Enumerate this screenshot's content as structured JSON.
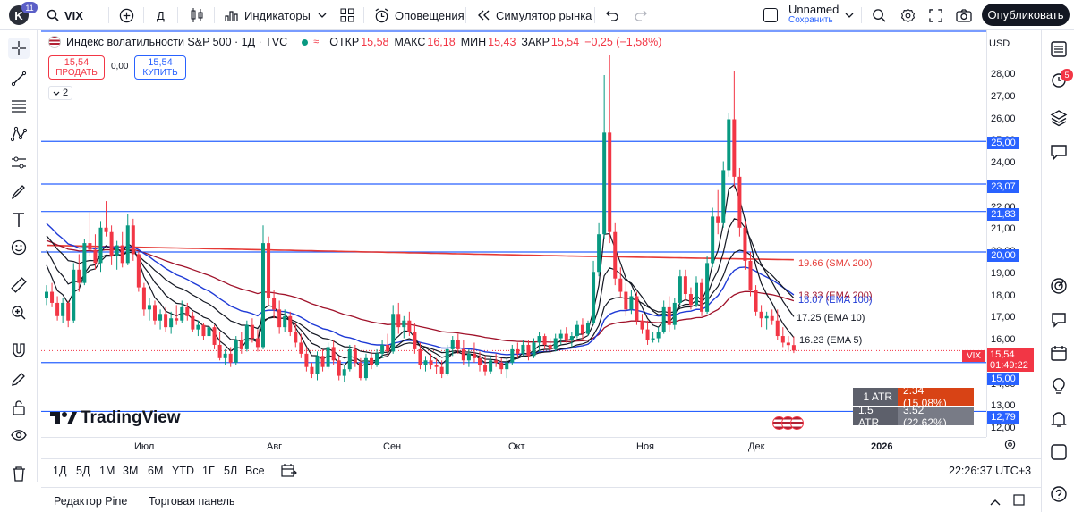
{
  "topbar": {
    "avatar_letter": "K",
    "avatar_badge": "11",
    "symbol": "VIX",
    "interval": "Д",
    "indicators_label": "Индикаторы",
    "alerts_label": "Оповещения",
    "replay_label": "Симулятор рынка",
    "layout_name": "Unnamed",
    "layout_status": "Сохранить",
    "publish_label": "Опубликовать"
  },
  "legend": {
    "title": "Индекс волатильности S&P 500 · 1Д · TVC",
    "open_label": "ОТКР",
    "open": "15,58",
    "high_label": "МАКС",
    "high": "16,18",
    "low_label": "МИН",
    "low": "15,43",
    "close_label": "ЗАКР",
    "close": "15,54",
    "change": "−0,25 (−1,58%)",
    "sell_price": "15,54",
    "sell_label": "ПРОДАТЬ",
    "spread": "0,00",
    "buy_price": "15,54",
    "buy_label": "КУПИТЬ",
    "collapse_count": "2"
  },
  "price_axis": {
    "currency": "USD",
    "labels": [
      "28,00",
      "27,00",
      "26,00",
      "25,00",
      "24,00",
      "23,00",
      "22,00",
      "21,00",
      "20,00",
      "19,00",
      "18,00",
      "17,00",
      "16,00",
      "15,00",
      "14,00",
      "13,00",
      "12,00"
    ]
  },
  "level_tags": [
    "25,00",
    "23,07",
    "21,83",
    "20,00",
    "15,00",
    "12,79"
  ],
  "price_tag": {
    "symbol": "VIX",
    "value": "15,54",
    "timer": "01:49:22"
  },
  "ma_labels": {
    "sma200": "19.66 (SMA 200)",
    "ema200": "18.33 (EMA 200)",
    "ema100": "18.07 (EMA 100)",
    "ema10": "17.25 (EMA 10)",
    "ema5": "16.23 (EMA 5)"
  },
  "atr": [
    {
      "label": "1 ATR",
      "value": "2.34 (15.08%)"
    },
    {
      "label": "1.5 ATR",
      "value": "3.52 (22.62%)"
    }
  ],
  "watermark": "TradingView",
  "time_axis": {
    "labels": [
      "Июл",
      "Авг",
      "Сен",
      "Окт",
      "Ноя",
      "Дек"
    ],
    "year": "2026"
  },
  "ranges": [
    "1Д",
    "5Д",
    "1М",
    "3М",
    "6М",
    "YTD",
    "1Г",
    "5Л",
    "Все"
  ],
  "clock": "22:26:37 UTC+3",
  "footer": {
    "pine": "Редактор Pine",
    "trading": "Торговая панель"
  },
  "alerts_badge": "5",
  "colors": {
    "up": "#089981",
    "down": "#f23645",
    "level": "#2962ff",
    "sma": "#e53935",
    "ema": "#1e3ad6"
  },
  "chart_data": {
    "type": "candlestick",
    "symbol": "VIX",
    "interval": "1D",
    "ylim": [
      12,
      28.8
    ],
    "horizontal_levels": [
      25.0,
      23.07,
      21.83,
      20.0,
      15.0,
      12.79
    ],
    "candles": [
      [
        17.9,
        18.5,
        17.6,
        18.2
      ],
      [
        18.2,
        18.6,
        17.5,
        17.7
      ],
      [
        17.7,
        18.0,
        16.9,
        17.1
      ],
      [
        17.1,
        17.9,
        16.8,
        17.7
      ],
      [
        17.7,
        17.8,
        16.6,
        16.9
      ],
      [
        16.9,
        19.5,
        16.8,
        19.2
      ],
      [
        19.2,
        19.9,
        18.2,
        18.6
      ],
      [
        18.6,
        20.6,
        18.5,
        20.4
      ],
      [
        20.4,
        21.8,
        19.8,
        20.1
      ],
      [
        20.1,
        20.8,
        19.2,
        19.5
      ],
      [
        19.5,
        21.4,
        19.1,
        21.1
      ],
      [
        21.1,
        22.3,
        20.7,
        20.9
      ],
      [
        20.9,
        21.2,
        19.4,
        19.8
      ],
      [
        19.8,
        20.5,
        19.2,
        20.3
      ],
      [
        20.3,
        20.9,
        19.3,
        19.5
      ],
      [
        19.5,
        21.7,
        19.4,
        21.2
      ],
      [
        21.2,
        21.5,
        19.6,
        19.9
      ],
      [
        19.9,
        20.0,
        18.2,
        18.4
      ],
      [
        18.4,
        18.6,
        17.1,
        17.4
      ],
      [
        17.4,
        17.9,
        16.9,
        17.6
      ],
      [
        17.6,
        17.8,
        16.7,
        16.9
      ],
      [
        16.9,
        17.4,
        16.5,
        17.2
      ],
      [
        17.2,
        17.5,
        16.4,
        16.6
      ],
      [
        16.6,
        17.3,
        16.3,
        17.0
      ],
      [
        17.0,
        17.6,
        16.7,
        16.9
      ],
      [
        16.9,
        17.8,
        16.8,
        17.5
      ],
      [
        17.5,
        17.7,
        16.9,
        17.1
      ],
      [
        17.1,
        17.3,
        16.4,
        16.5
      ],
      [
        16.5,
        16.9,
        16.2,
        16.7
      ],
      [
        16.7,
        16.8,
        16.0,
        16.2
      ],
      [
        16.2,
        16.9,
        15.9,
        16.6
      ],
      [
        16.6,
        16.7,
        15.6,
        15.8
      ],
      [
        15.8,
        16.4,
        15.1,
        15.2
      ],
      [
        15.2,
        15.6,
        14.9,
        15.4
      ],
      [
        15.4,
        15.7,
        14.8,
        15.0
      ],
      [
        15.0,
        16.2,
        14.9,
        16.0
      ],
      [
        16.0,
        16.4,
        15.4,
        15.6
      ],
      [
        15.6,
        16.9,
        15.5,
        16.7
      ],
      [
        16.7,
        17.0,
        15.9,
        16.1
      ],
      [
        16.1,
        16.5,
        15.5,
        15.7
      ],
      [
        15.7,
        21.2,
        15.6,
        20.4
      ],
      [
        20.4,
        20.7,
        17.6,
        17.9
      ],
      [
        17.9,
        18.3,
        17.0,
        17.4
      ],
      [
        17.4,
        17.8,
        16.3,
        16.6
      ],
      [
        16.6,
        17.4,
        16.4,
        17.1
      ],
      [
        17.1,
        17.3,
        16.2,
        16.4
      ],
      [
        16.4,
        16.8,
        15.7,
        15.9
      ],
      [
        15.9,
        16.3,
        15.2,
        15.4
      ],
      [
        15.4,
        15.7,
        14.6,
        14.8
      ],
      [
        14.8,
        15.0,
        14.3,
        14.5
      ],
      [
        14.5,
        15.5,
        14.2,
        15.3
      ],
      [
        15.3,
        15.6,
        14.6,
        14.8
      ],
      [
        14.8,
        15.9,
        14.7,
        15.7
      ],
      [
        15.7,
        16.0,
        14.9,
        15.1
      ],
      [
        15.1,
        15.3,
        14.2,
        14.4
      ],
      [
        14.4,
        14.9,
        14.1,
        14.7
      ],
      [
        14.7,
        15.8,
        14.6,
        15.6
      ],
      [
        15.6,
        15.8,
        14.8,
        15.0
      ],
      [
        15.0,
        15.2,
        14.2,
        14.3
      ],
      [
        14.3,
        15.4,
        14.2,
        15.2
      ],
      [
        15.2,
        15.5,
        14.7,
        14.9
      ],
      [
        14.9,
        15.6,
        14.8,
        15.4
      ],
      [
        15.4,
        16.0,
        15.2,
        15.8
      ],
      [
        15.8,
        16.3,
        15.3,
        15.5
      ],
      [
        15.5,
        17.6,
        15.4,
        17.2
      ],
      [
        17.2,
        17.7,
        16.3,
        16.6
      ],
      [
        16.6,
        17.1,
        16.1,
        16.9
      ],
      [
        16.9,
        17.3,
        16.2,
        16.4
      ],
      [
        16.4,
        16.8,
        15.4,
        15.6
      ],
      [
        15.6,
        15.9,
        14.7,
        14.9
      ],
      [
        14.9,
        15.3,
        14.6,
        15.1
      ],
      [
        15.1,
        15.4,
        14.7,
        14.9
      ],
      [
        14.9,
        15.2,
        14.5,
        14.8
      ],
      [
        14.8,
        15.1,
        14.3,
        14.5
      ],
      [
        14.5,
        15.8,
        14.4,
        15.6
      ],
      [
        15.6,
        16.2,
        15.3,
        16.0
      ],
      [
        16.0,
        16.3,
        15.4,
        15.6
      ],
      [
        15.6,
        16.0,
        14.9,
        15.1
      ],
      [
        15.1,
        15.6,
        14.8,
        15.4
      ],
      [
        15.4,
        15.9,
        15.0,
        15.2
      ],
      [
        15.2,
        15.5,
        14.6,
        14.9
      ],
      [
        14.9,
        15.3,
        14.4,
        14.6
      ],
      [
        14.6,
        15.3,
        14.5,
        15.1
      ],
      [
        15.1,
        15.4,
        14.8,
        15.0
      ],
      [
        15.0,
        15.2,
        14.5,
        14.7
      ],
      [
        14.7,
        15.2,
        14.3,
        15.0
      ],
      [
        15.0,
        15.8,
        14.9,
        15.6
      ],
      [
        15.6,
        15.9,
        15.2,
        15.4
      ],
      [
        15.4,
        16.0,
        15.3,
        15.8
      ],
      [
        15.8,
        16.0,
        15.1,
        15.3
      ],
      [
        15.3,
        16.1,
        15.2,
        15.9
      ],
      [
        15.9,
        16.4,
        15.5,
        16.2
      ],
      [
        16.2,
        16.3,
        15.6,
        15.8
      ],
      [
        15.8,
        16.1,
        15.4,
        15.6
      ],
      [
        15.6,
        16.3,
        15.5,
        16.1
      ],
      [
        16.1,
        16.5,
        15.8,
        16.3
      ],
      [
        16.3,
        16.6,
        15.9,
        16.0
      ],
      [
        16.0,
        16.4,
        15.7,
        16.2
      ],
      [
        16.2,
        16.9,
        16.1,
        16.7
      ],
      [
        16.7,
        17.0,
        16.0,
        16.3
      ],
      [
        16.3,
        16.9,
        16.2,
        16.8
      ],
      [
        16.8,
        19.6,
        16.7,
        19.1
      ],
      [
        19.1,
        21.3,
        18.9,
        20.8
      ],
      [
        20.8,
        28.0,
        20.6,
        25.4
      ],
      [
        25.4,
        28.9,
        20.4,
        20.9
      ],
      [
        20.9,
        21.3,
        18.5,
        18.8
      ],
      [
        18.8,
        19.3,
        17.9,
        18.2
      ],
      [
        18.2,
        18.6,
        17.1,
        17.4
      ],
      [
        17.4,
        18.3,
        17.2,
        18.0
      ],
      [
        18.0,
        18.2,
        16.7,
        16.9
      ],
      [
        16.9,
        17.2,
        16.3,
        16.5
      ],
      [
        16.5,
        16.9,
        15.8,
        16.0
      ],
      [
        16.0,
        16.4,
        15.9,
        16.1
      ],
      [
        16.1,
        16.6,
        15.9,
        16.4
      ],
      [
        16.4,
        17.8,
        16.3,
        17.5
      ],
      [
        17.5,
        18.0,
        16.4,
        16.7
      ],
      [
        16.7,
        17.9,
        16.5,
        17.7
      ],
      [
        17.7,
        19.2,
        17.6,
        18.9
      ],
      [
        18.9,
        19.2,
        17.8,
        18.1
      ],
      [
        18.1,
        18.4,
        17.4,
        17.6
      ],
      [
        17.6,
        18.9,
        17.5,
        18.6
      ],
      [
        18.6,
        18.8,
        17.1,
        17.3
      ],
      [
        17.3,
        19.8,
        17.2,
        19.5
      ],
      [
        19.5,
        22.0,
        19.3,
        21.6
      ],
      [
        21.6,
        22.8,
        20.8,
        21.3
      ],
      [
        21.3,
        24.1,
        21.1,
        23.7
      ],
      [
        23.7,
        26.3,
        23.4,
        26.0
      ],
      [
        26.0,
        28.2,
        22.9,
        23.4
      ],
      [
        23.4,
        23.8,
        20.7,
        21.1
      ],
      [
        21.1,
        21.4,
        19.2,
        19.6
      ],
      [
        19.6,
        20.0,
        18.0,
        18.3
      ],
      [
        18.3,
        18.5,
        17.1,
        17.3
      ],
      [
        17.3,
        17.6,
        16.6,
        17.0
      ],
      [
        17.0,
        17.3,
        16.5,
        17.1
      ],
      [
        17.1,
        17.4,
        16.7,
        16.9
      ],
      [
        16.9,
        17.4,
        16.0,
        16.2
      ],
      [
        16.2,
        16.6,
        15.7,
        15.9
      ],
      [
        15.9,
        16.2,
        15.5,
        15.79
      ],
      [
        15.79,
        16.18,
        15.43,
        15.54
      ]
    ]
  }
}
